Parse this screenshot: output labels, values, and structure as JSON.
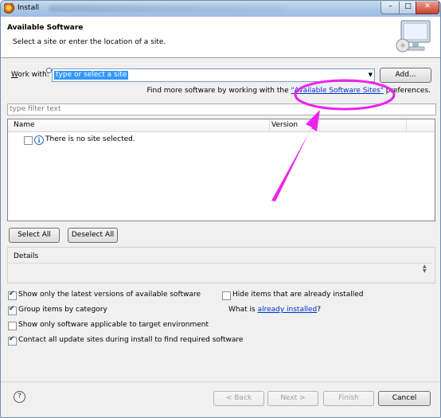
{
  "window": {
    "title": "Install"
  },
  "title_buttons": {
    "minimize": "–",
    "maximize": "□",
    "close": "✕"
  },
  "header": {
    "title": "Available Software",
    "description": "Select a site or enter the location of a site."
  },
  "work_with": {
    "label_prefix": "W",
    "label_rest": "ork with:",
    "value": "type or select a site",
    "add_label": "Add...",
    "dropdown_icon": "▼"
  },
  "find_more": {
    "prefix": "Find more software by working with the ",
    "link": "\"Available Software Sites\"",
    "suffix": " preferences."
  },
  "filter": {
    "placeholder": "type filter text"
  },
  "tree": {
    "columns": [
      "Name",
      "Version"
    ],
    "rows": [
      {
        "text": "There is no site selected.",
        "checked": false
      }
    ]
  },
  "selection": {
    "select_all": "Select All",
    "deselect_all": "Deselect All"
  },
  "details": {
    "label": "Details",
    "scroll_up": "▲",
    "scroll_down": "▼"
  },
  "options": {
    "latest_versions": {
      "label": "Show only the latest versions of available software",
      "checked": true
    },
    "group_by_category": {
      "label": "Group items by category",
      "checked": true
    },
    "applicable_only": {
      "label": "Show only software applicable to target environment",
      "checked": false
    },
    "contact_all_sites": {
      "label": "Contact all update sites during install to find required software",
      "checked": true
    },
    "hide_installed": {
      "label": "Hide items that are already installed",
      "checked": false
    }
  },
  "what_is": {
    "prefix": "What is ",
    "link": "already installed",
    "suffix": "?"
  },
  "footer": {
    "help_icon": "?",
    "back": "< Back",
    "next": "Next >",
    "finish": "Finish",
    "cancel": "Cancel"
  },
  "colors": {
    "annotation": "#ee22ee",
    "link": "#0033cc",
    "selection": "#3399ff"
  }
}
